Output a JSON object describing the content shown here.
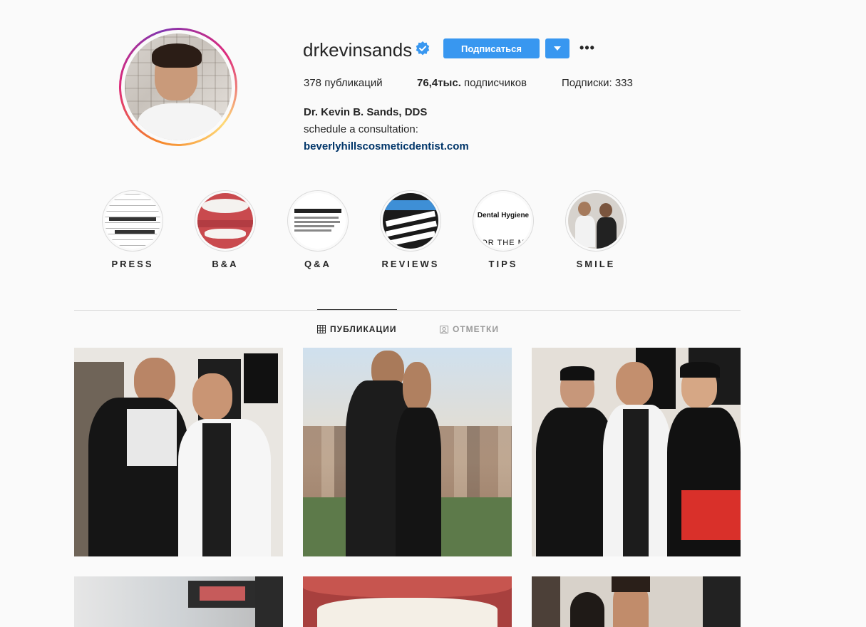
{
  "profile": {
    "username": "drkevinsands",
    "verified": true,
    "follow_label": "Подписаться",
    "dropdown_icon": "triangle-down-icon",
    "more_label": "•••",
    "stats": {
      "posts": "378",
      "posts_label": "публикаций",
      "followers": "76,4тыс.",
      "followers_label": "подписчиков",
      "following_label": "Подписки:",
      "following": "333"
    },
    "bio": {
      "name": "Dr. Kevin B. Sands, DDS",
      "line": "schedule a consultation:",
      "link": "beverlyhillscosmeticdentist.com"
    }
  },
  "highlights": [
    {
      "label": "PRESS"
    },
    {
      "label": "B&A"
    },
    {
      "label": "Q&A"
    },
    {
      "label": "REVIEWS"
    },
    {
      "label": "TIPS",
      "cover_text": "Dental Hygiene",
      "cover_subtext": "OR THE M"
    },
    {
      "label": "SMILE"
    }
  ],
  "tabs": [
    {
      "label": "ПУБЛИКАЦИИ",
      "icon": "grid-icon",
      "active": true
    },
    {
      "label": "ОТМЕТКИ",
      "icon": "tagged-icon",
      "active": false
    }
  ],
  "colors": {
    "primary_button": "#3897f0",
    "link": "#003569",
    "verified_badge": "#3897f0"
  }
}
